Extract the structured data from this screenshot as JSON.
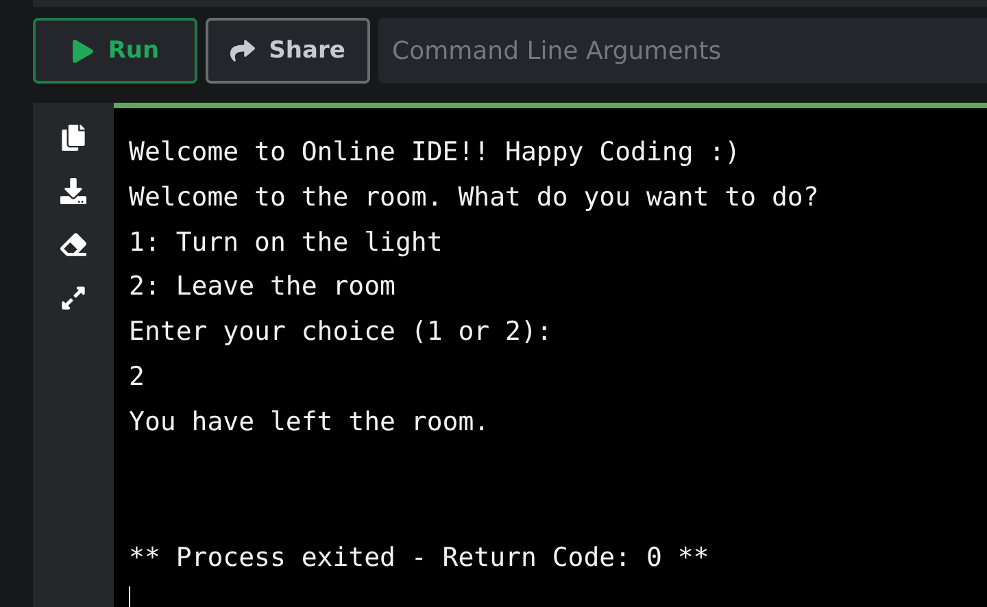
{
  "toolbar": {
    "run_button": {
      "label": "Run"
    },
    "share_button": {
      "label": "Share"
    },
    "arguments_field": {
      "placeholder": "Command Line Arguments"
    }
  },
  "sidebar": {
    "tools": [
      {
        "kind": "copy"
      },
      {
        "kind": "download"
      },
      {
        "kind": "erase"
      },
      {
        "kind": "expand"
      }
    ]
  },
  "terminal": {
    "lines": [
      {
        "kind": "output",
        "text": "Welcome to Online IDE!! Happy Coding :)"
      },
      {
        "kind": "output",
        "text": "Welcome to the room. What do you want to do?"
      },
      {
        "kind": "output",
        "text": "1: Turn on the light"
      },
      {
        "kind": "output",
        "text": "2: Leave the room"
      },
      {
        "kind": "output",
        "text": "Enter your choice (1 or 2):"
      },
      {
        "kind": "output",
        "text": "2"
      },
      {
        "kind": "output",
        "text": "You have left the room."
      },
      {
        "kind": "status",
        "text": "** Process exited - Return Code: 0 **"
      }
    ]
  }
}
